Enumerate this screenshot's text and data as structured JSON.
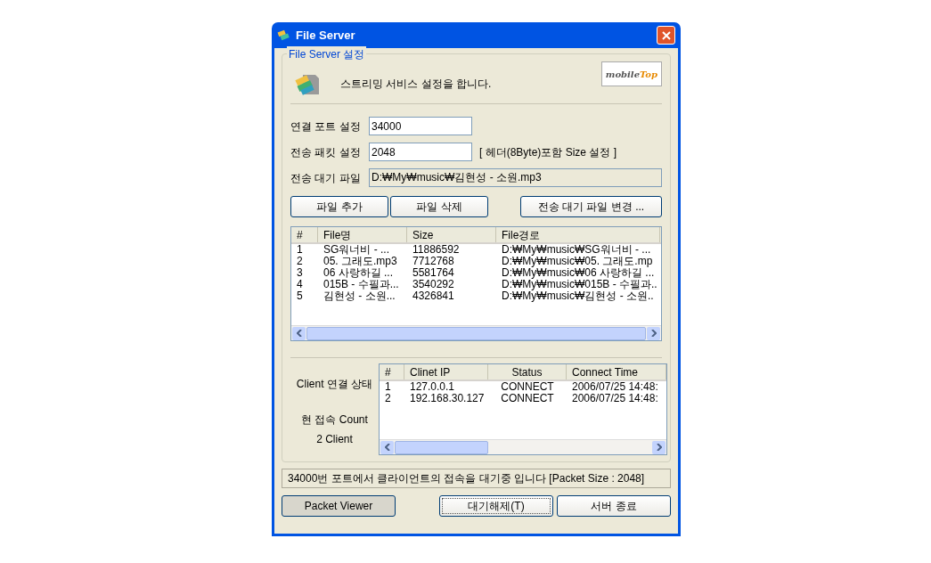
{
  "window": {
    "title": "File Server"
  },
  "settings": {
    "legend": "File Server 설정",
    "description": "스트리밍 서비스 설정을 합니다.",
    "logo": {
      "part_1": "mobile",
      "part_2": "Top"
    },
    "fields": [
      {
        "label": "연결 포트 설정",
        "value": "34000",
        "readonly": false
      },
      {
        "label": "전송 패킷 설정",
        "value": "2048",
        "note": "[ 헤더(8Byte)포함 Size 설정 ]",
        "readonly": false
      },
      {
        "label": "전송 대기 파일",
        "value": "D:₩My₩music₩김현성 - 소원.mp3",
        "readonly": true
      }
    ],
    "buttons": [
      "파일 추가",
      "파일 삭제",
      "전송 대기 파일 변경 ..."
    ]
  },
  "file_table": {
    "columns": [
      "#",
      "File명",
      "Size",
      "File경로"
    ],
    "rows": [
      [
        "1",
        "SG워너비 - ...",
        "11886592",
        "D:₩My₩music₩SG워너비 - ..."
      ],
      [
        "2",
        "05. 그래도.mp3",
        "7712768",
        "D:₩My₩music₩05. 그래도.mp"
      ],
      [
        "3",
        "06 사랑하길 ...",
        "5581764",
        "D:₩My₩music₩06 사랑하길 ..."
      ],
      [
        "4",
        "015B - 수필과...",
        "3540292",
        "D:₩My₩music₩015B - 수필과.."
      ],
      [
        "5",
        "김현성 - 소원...",
        "4326841",
        "D:₩My₩music₩김현성 - 소원.."
      ]
    ]
  },
  "clients": {
    "label": "Client 연결 상태",
    "count_label": "현 접속 Count",
    "count": "2 Client",
    "columns": [
      "#",
      "Clinet IP",
      "Status",
      "Connect Time"
    ],
    "rows": [
      [
        "1",
        "127.0.0.1",
        "CONNECT",
        "2006/07/25 14:48:"
      ],
      [
        "2",
        "192.168.30.127",
        "CONNECT",
        "2006/07/25 14:48:"
      ]
    ]
  },
  "status_bar": "34000번 포트에서 클라이언트의 접속을 대기중 입니다 [Packet Size : 2048]",
  "footer_buttons": [
    {
      "label": "Packet Viewer",
      "pressed": true,
      "default": false
    },
    {
      "label": "대기해제(T)",
      "pressed": false,
      "default": true
    },
    {
      "label": "서버 종료",
      "pressed": false,
      "default": false
    }
  ]
}
